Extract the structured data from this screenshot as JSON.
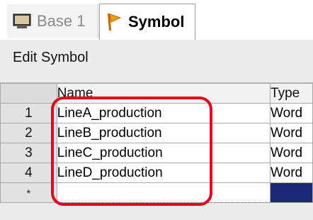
{
  "tabs": [
    {
      "label": "Base 1",
      "icon": "monitor-icon",
      "active": false
    },
    {
      "label": "Symbol",
      "icon": "symbol-icon",
      "active": true
    }
  ],
  "panel": {
    "title": "Edit Symbol"
  },
  "table": {
    "columns": [
      "Name",
      "Type"
    ],
    "rows": [
      {
        "num": "1",
        "name": "LineA_production",
        "type": "Word"
      },
      {
        "num": "2",
        "name": "LineB_production",
        "type": "Word"
      },
      {
        "num": "3",
        "name": "LineC_production",
        "type": "Word"
      },
      {
        "num": "4",
        "name": "LineD_production",
        "type": "Word"
      }
    ],
    "new_row_marker": "*"
  },
  "colors": {
    "highlight": "#e8001c",
    "selected_cell": "#1a2a78"
  }
}
